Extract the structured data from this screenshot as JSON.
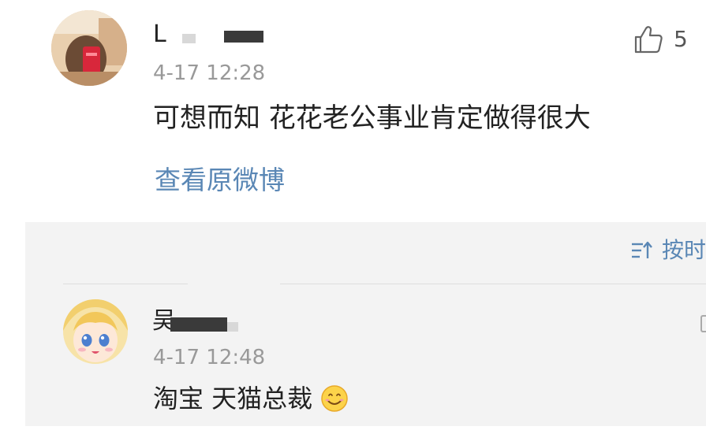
{
  "comment": {
    "author_initial": "L",
    "timestamp": "4-17 12:28",
    "text": "可想而知 花花老公事业肯定做得很大",
    "like_count": "5",
    "view_original_label": "查看原微博"
  },
  "replies_panel": {
    "sort_label": "按时",
    "reply": {
      "author_initial": "吴",
      "timestamp": "4-17 12:48",
      "text": "淘宝 天猫总裁"
    }
  },
  "icons": {
    "like": "thumbs-up-icon",
    "sort": "sort-icon",
    "emoji": "smiley-icon"
  },
  "colors": {
    "link": "#5a87b5",
    "timestamp": "#999999",
    "panel_bg": "#f3f3f3"
  }
}
